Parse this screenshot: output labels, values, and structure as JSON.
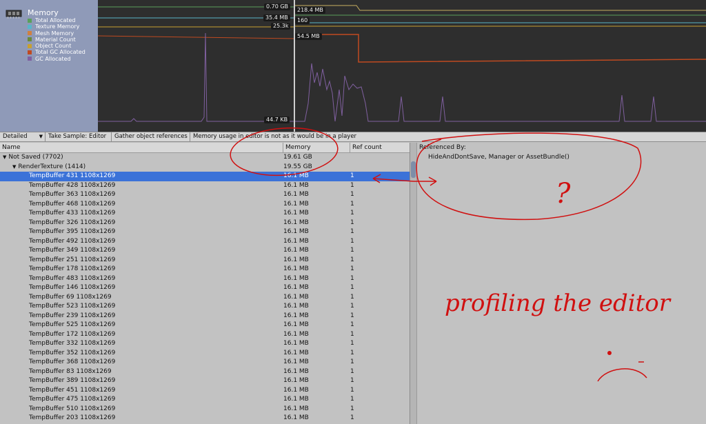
{
  "legend": {
    "title": "Memory",
    "items": [
      {
        "label": "Total Allocated",
        "color": "#5aa05a"
      },
      {
        "label": "Texture Memory",
        "color": "#5ab5c8"
      },
      {
        "label": "Mesh Memory",
        "color": "#d08040"
      },
      {
        "label": "Material Count",
        "color": "#6a8a3a"
      },
      {
        "label": "Object Count",
        "color": "#c8a030"
      },
      {
        "label": "Total GC Allocated",
        "color": "#c04a20"
      },
      {
        "label": "GC Allocated",
        "color": "#8060a0"
      }
    ]
  },
  "graph": {
    "labels": {
      "total_allocated": "0.70 GB",
      "texture_memory": "35.4 MB",
      "object_count": "25.3k",
      "gc_low": "44.7 KB",
      "mesh": "218.4 MB",
      "material": "160",
      "total_gc": "54.5 MB"
    }
  },
  "toolbar": {
    "mode": "Detailed",
    "take_sample": "Take Sample: Editor",
    "gather": "Gather object references",
    "warning": "Memory usage in editor is not as it would be in a player"
  },
  "table": {
    "headers": {
      "name": "Name",
      "memory": "Memory",
      "ref": "Ref count"
    },
    "groups": [
      {
        "name": "Not Saved (7702)",
        "memory": "19.61 GB"
      },
      {
        "name": "RenderTexture (1414)",
        "memory": "19.55 GB"
      }
    ],
    "rows": [
      {
        "name": "TempBuffer 431 1108x1269",
        "memory": "16.1 MB",
        "ref": "1"
      },
      {
        "name": "TempBuffer 428 1108x1269",
        "memory": "16.1 MB",
        "ref": "1"
      },
      {
        "name": "TempBuffer 363 1108x1269",
        "memory": "16.1 MB",
        "ref": "1"
      },
      {
        "name": "TempBuffer 468 1108x1269",
        "memory": "16.1 MB",
        "ref": "1"
      },
      {
        "name": "TempBuffer 433 1108x1269",
        "memory": "16.1 MB",
        "ref": "1"
      },
      {
        "name": "TempBuffer 326 1108x1269",
        "memory": "16.1 MB",
        "ref": "1"
      },
      {
        "name": "TempBuffer 395 1108x1269",
        "memory": "16.1 MB",
        "ref": "1"
      },
      {
        "name": "TempBuffer 492 1108x1269",
        "memory": "16.1 MB",
        "ref": "1"
      },
      {
        "name": "TempBuffer 349 1108x1269",
        "memory": "16.1 MB",
        "ref": "1"
      },
      {
        "name": "TempBuffer 251 1108x1269",
        "memory": "16.1 MB",
        "ref": "1"
      },
      {
        "name": "TempBuffer 178 1108x1269",
        "memory": "16.1 MB",
        "ref": "1"
      },
      {
        "name": "TempBuffer 483 1108x1269",
        "memory": "16.1 MB",
        "ref": "1"
      },
      {
        "name": "TempBuffer 146 1108x1269",
        "memory": "16.1 MB",
        "ref": "1"
      },
      {
        "name": "TempBuffer 69 1108x1269",
        "memory": "16.1 MB",
        "ref": "1"
      },
      {
        "name": "TempBuffer 523 1108x1269",
        "memory": "16.1 MB",
        "ref": "1"
      },
      {
        "name": "TempBuffer 239 1108x1269",
        "memory": "16.1 MB",
        "ref": "1"
      },
      {
        "name": "TempBuffer 525 1108x1269",
        "memory": "16.1 MB",
        "ref": "1"
      },
      {
        "name": "TempBuffer 172 1108x1269",
        "memory": "16.1 MB",
        "ref": "1"
      },
      {
        "name": "TempBuffer 332 1108x1269",
        "memory": "16.1 MB",
        "ref": "1"
      },
      {
        "name": "TempBuffer 352 1108x1269",
        "memory": "16.1 MB",
        "ref": "1"
      },
      {
        "name": "TempBuffer 368 1108x1269",
        "memory": "16.1 MB",
        "ref": "1"
      },
      {
        "name": "TempBuffer 83 1108x1269",
        "memory": "16.1 MB",
        "ref": "1"
      },
      {
        "name": "TempBuffer 389 1108x1269",
        "memory": "16.1 MB",
        "ref": "1"
      },
      {
        "name": "TempBuffer 451 1108x1269",
        "memory": "16.1 MB",
        "ref": "1"
      },
      {
        "name": "TempBuffer 475 1108x1269",
        "memory": "16.1 MB",
        "ref": "1"
      },
      {
        "name": "TempBuffer 510 1108x1269",
        "memory": "16.1 MB",
        "ref": "1"
      },
      {
        "name": "TempBuffer 203 1108x1269",
        "memory": "16.1 MB",
        "ref": "1"
      }
    ]
  },
  "references": {
    "header": "Referenced By:",
    "value": "HideAndDontSave, Manager or AssetBundle()"
  },
  "annotation": {
    "question": "?",
    "note": "profiling the editor",
    "color": "#d01010"
  }
}
